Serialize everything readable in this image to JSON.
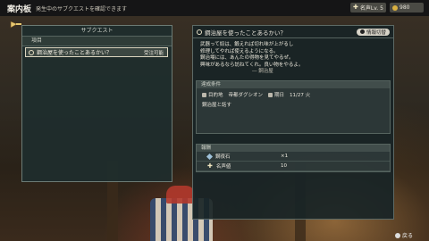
{
  "topbar": {
    "title": "案内板",
    "subtitle": "発生中のサブクエストを確認できます",
    "fame_label": "名声Lv. 5",
    "gold_value": "980"
  },
  "left_panel": {
    "header": "サブクエスト",
    "column_label": "項目",
    "quests": [
      {
        "title": "鋼治屋を使ったことあるかい？",
        "status": "受注可能"
      }
    ]
  },
  "detail": {
    "title": "鋼治屋を使ったことあるかい？",
    "button_label": "情報切替",
    "description": [
      "武器って奴は、鍛えれば切れ味が上がるし",
      "修理してやれば使えるようになる。",
      "鋼治場には、あんたの得物を見てやるぜ。",
      "興味があるなら訪ねてくれ。良い物をやるよ。"
    ],
    "giver": "― 鋼治屋",
    "conditions_header": "達成条件",
    "destination_label": "目的地",
    "destination": "帝都ダグシオン",
    "date_label": "期日",
    "date": "11/27 火",
    "condition_text": "鋼治屋と話す",
    "rewards_header": "報酬",
    "rewards": [
      {
        "name": "鋼夜石",
        "qty": "×1",
        "icon": "gem-icon"
      },
      {
        "name": "名声値",
        "qty": "10",
        "icon": "plus-icon"
      }
    ]
  },
  "footer": {
    "back_label": "戻る"
  }
}
